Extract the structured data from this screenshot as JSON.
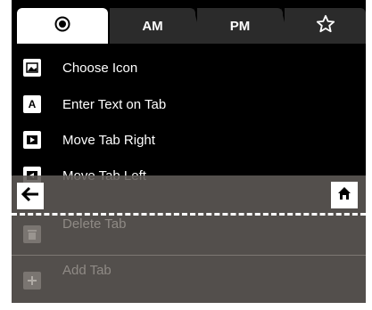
{
  "tabs": [
    {
      "label": "",
      "icon": "radio-dot-icon"
    },
    {
      "label": "AM"
    },
    {
      "label": "PM"
    },
    {
      "label": "",
      "icon": "star-outline-icon"
    }
  ],
  "menu": [
    {
      "label": "Choose Icon",
      "icon": "image-icon"
    },
    {
      "label": "Enter Text on Tab",
      "icon_text": "A"
    },
    {
      "label": "Move Tab Right",
      "icon": "arrow-right-box-icon"
    },
    {
      "label": "Move Tab Left",
      "icon": "arrow-left-box-icon"
    }
  ],
  "dimmed_menu": [
    {
      "label": "Delete Tab",
      "icon": "trash-icon"
    },
    {
      "label": "Add Tab",
      "icon": "plus-icon"
    }
  ],
  "nav": {
    "back_icon": "arrow-left-icon",
    "home_icon": "home-icon"
  }
}
